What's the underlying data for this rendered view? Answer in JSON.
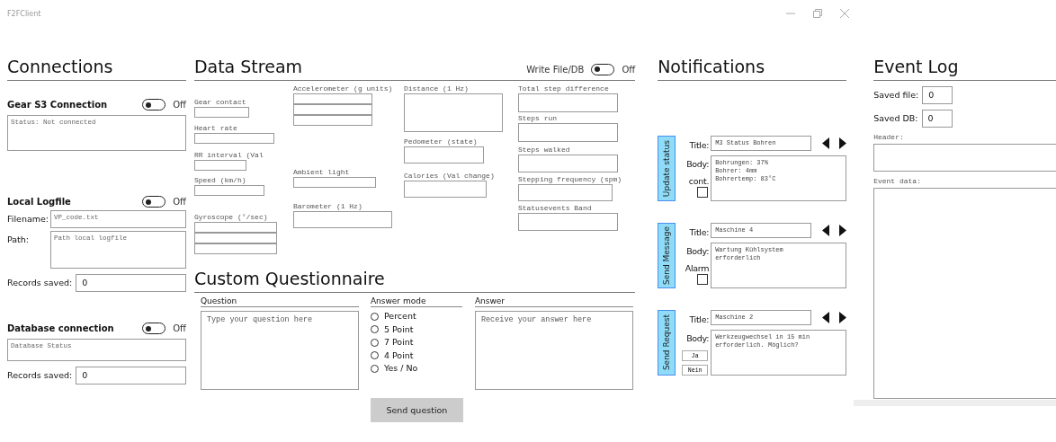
{
  "window": {
    "title": "F2FClient"
  },
  "connections": {
    "title": "Connections",
    "sections": [
      {
        "kind": "status",
        "title": "Gear S3 Connection",
        "toggle": {
          "on": false,
          "label": "Off"
        },
        "status": "Status: Not connected"
      },
      {
        "kind": "logfile",
        "title": "Local Logfile",
        "toggle": {
          "on": false,
          "label": "Off"
        },
        "filename": {
          "label": "Filename:",
          "value": "VP_code.txt"
        },
        "path": {
          "label": "Path:",
          "value": "Path local logfile"
        },
        "records": {
          "label": "Records saved:",
          "value": "0"
        }
      },
      {
        "kind": "database",
        "title": "Database connection",
        "toggle": {
          "on": false,
          "label": "Off"
        },
        "status": "Database Status",
        "records": {
          "label": "Records saved:",
          "value": "0"
        }
      }
    ]
  },
  "data_stream": {
    "title": "Data Stream",
    "write_toggle": {
      "label": "Write File/DB",
      "on": false,
      "state_label": "Off"
    },
    "columns": [
      [
        {
          "label": "Gear contact",
          "kind": "single"
        },
        {
          "label": "Heart rate",
          "kind": "single"
        },
        {
          "label": "RR interval (Val",
          "kind": "single"
        },
        {
          "label": "Speed (km/h)",
          "kind": "single"
        },
        {
          "label": "Gyroscope (°/sec)",
          "kind": "triple"
        }
      ],
      [
        {
          "label": "Accelerometer (g units)",
          "kind": "triple"
        },
        {
          "label": "Ambient light",
          "kind": "single"
        },
        {
          "label": "Barometer (1 Hz)",
          "kind": "single"
        }
      ],
      [
        {
          "label": "Distance (1 Hz)",
          "kind": "single"
        },
        {
          "label": "Pedometer (state)",
          "kind": "single"
        },
        {
          "label": "Calories (Val change)",
          "kind": "single"
        }
      ],
      [
        {
          "label": "Total step difference",
          "kind": "single"
        },
        {
          "label": "Steps run",
          "kind": "single"
        },
        {
          "label": "Steps walked",
          "kind": "single"
        },
        {
          "label": "Stepping frequency (spm)",
          "kind": "single"
        },
        {
          "label": "Statusevents Band",
          "kind": "single"
        }
      ]
    ]
  },
  "questionnaire": {
    "title": "Custom Questionnaire",
    "question": {
      "label": "Question",
      "placeholder": "Type your question here"
    },
    "answer_mode": {
      "label": "Answer mode",
      "options": [
        {
          "label": "Percent",
          "selected": false
        },
        {
          "label": "5 Point",
          "selected": false
        },
        {
          "label": "7 Point",
          "selected": false
        },
        {
          "label": "4 Point",
          "selected": false
        },
        {
          "label": "Yes / No",
          "selected": false
        }
      ]
    },
    "answer": {
      "label": "Answer",
      "placeholder": "Receive your answer here"
    },
    "send_button": "Send question"
  },
  "notifications": {
    "title": "Notifications",
    "cards": [
      {
        "kind": "status",
        "button": "Update status",
        "title_label": "Title:",
        "title_value": "M3 Status Bohren",
        "body_label": "Body:",
        "body": "Bohrungen: 37%\nBohrer: 4mm\nBohrertemp: 83°C",
        "checkbox": {
          "label": "cont.",
          "checked": false
        }
      },
      {
        "kind": "message",
        "button": "Send Message",
        "title_label": "Title:",
        "title_value": "Maschine 4",
        "body_label": "Body:",
        "body": "Wartung Kühlsystem\nerforderlich",
        "checkbox": {
          "label": "Alarm",
          "checked": false
        }
      },
      {
        "kind": "request",
        "button": "Send Request",
        "title_label": "Title:",
        "title_value": "Maschine 2",
        "body_label": "Body:",
        "body": "Werkzeugwechsel in 15 min\nerforderlich. Möglich?",
        "reply_buttons": [
          "Ja",
          "Nein"
        ]
      }
    ]
  },
  "event_log": {
    "title": "Event Log",
    "saved_file": {
      "label": "Saved file:",
      "value": "0"
    },
    "saved_db": {
      "label": "Saved DB:",
      "value": "0"
    },
    "header": {
      "label": "Header:"
    },
    "event_data": {
      "label": "Event data:"
    }
  }
}
